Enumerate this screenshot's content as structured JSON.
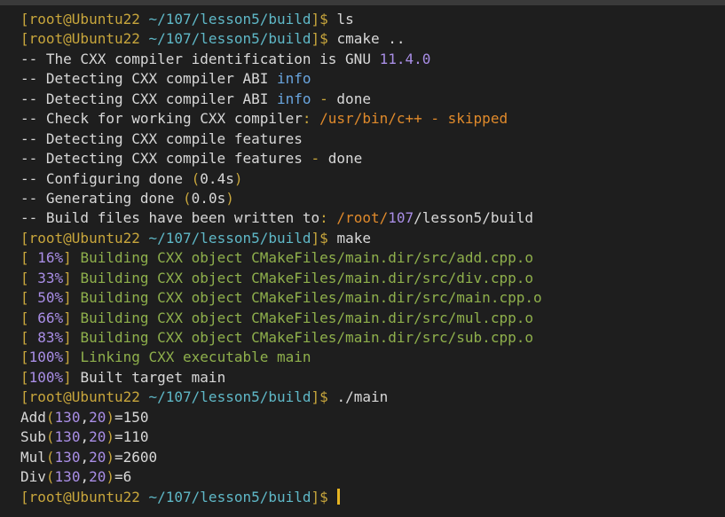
{
  "terminal": {
    "lines": [
      {
        "segments": [
          {
            "t": "[root@Ubuntu22 ",
            "c": "yellow"
          },
          {
            "t": "~/107/lesson5/build",
            "c": "cyan"
          },
          {
            "t": "]$ ",
            "c": "yellow"
          },
          {
            "t": "ls",
            "c": "default"
          }
        ]
      },
      {
        "segments": [
          {
            "t": "[root@Ubuntu22 ",
            "c": "yellow"
          },
          {
            "t": "~/107/lesson5/build",
            "c": "cyan"
          },
          {
            "t": "]$ ",
            "c": "yellow"
          },
          {
            "t": "cmake ..",
            "c": "default"
          }
        ]
      },
      {
        "segments": [
          {
            "t": "-- The CXX compiler identification is GNU ",
            "c": "default"
          },
          {
            "t": "11.4.0",
            "c": "purple"
          }
        ]
      },
      {
        "segments": [
          {
            "t": "-- Detecting CXX compiler ABI ",
            "c": "default"
          },
          {
            "t": "info",
            "c": "blue"
          }
        ]
      },
      {
        "segments": [
          {
            "t": "-- Detecting CXX compiler ABI ",
            "c": "default"
          },
          {
            "t": "info",
            "c": "blue"
          },
          {
            "t": " - ",
            "c": "yellow"
          },
          {
            "t": "done",
            "c": "default"
          }
        ]
      },
      {
        "segments": [
          {
            "t": "-- Check for working CXX compiler",
            "c": "default"
          },
          {
            "t": ": ",
            "c": "yellow"
          },
          {
            "t": "/usr/bin/c++ - skipped",
            "c": "orange"
          }
        ]
      },
      {
        "segments": [
          {
            "t": "-- Detecting CXX compile features",
            "c": "default"
          }
        ]
      },
      {
        "segments": [
          {
            "t": "-- Detecting CXX compile features ",
            "c": "default"
          },
          {
            "t": "- ",
            "c": "yellow"
          },
          {
            "t": "done",
            "c": "default"
          }
        ]
      },
      {
        "segments": [
          {
            "t": "-- Configuring done ",
            "c": "default"
          },
          {
            "t": "(",
            "c": "yellow"
          },
          {
            "t": "0.4s",
            "c": "default"
          },
          {
            "t": ")",
            "c": "yellow"
          }
        ]
      },
      {
        "segments": [
          {
            "t": "-- Generating done ",
            "c": "default"
          },
          {
            "t": "(",
            "c": "yellow"
          },
          {
            "t": "0.0s",
            "c": "default"
          },
          {
            "t": ")",
            "c": "yellow"
          }
        ]
      },
      {
        "segments": [
          {
            "t": "-- Build files have been written to",
            "c": "default"
          },
          {
            "t": ": ",
            "c": "yellow"
          },
          {
            "t": "/root/",
            "c": "orange"
          },
          {
            "t": "107",
            "c": "purple"
          },
          {
            "t": "/lesson5/build",
            "c": "default"
          }
        ]
      },
      {
        "segments": [
          {
            "t": "[root@Ubuntu22 ",
            "c": "yellow"
          },
          {
            "t": "~/107/lesson5/build",
            "c": "cyan"
          },
          {
            "t": "]$ ",
            "c": "yellow"
          },
          {
            "t": "make",
            "c": "default"
          }
        ]
      },
      {
        "segments": [
          {
            "t": "[ ",
            "c": "yellow"
          },
          {
            "t": "16%",
            "c": "purple"
          },
          {
            "t": "] ",
            "c": "yellow"
          },
          {
            "t": "Building CXX object CMakeFiles/main.dir/src/add.cpp.o",
            "c": "green"
          }
        ]
      },
      {
        "segments": [
          {
            "t": "[ ",
            "c": "yellow"
          },
          {
            "t": "33%",
            "c": "purple"
          },
          {
            "t": "] ",
            "c": "yellow"
          },
          {
            "t": "Building CXX object CMakeFiles/main.dir/src/div.cpp.o",
            "c": "green"
          }
        ]
      },
      {
        "segments": [
          {
            "t": "[ ",
            "c": "yellow"
          },
          {
            "t": "50%",
            "c": "purple"
          },
          {
            "t": "] ",
            "c": "yellow"
          },
          {
            "t": "Building CXX object CMakeFiles/main.dir/src/main.cpp.o",
            "c": "green"
          }
        ]
      },
      {
        "segments": [
          {
            "t": "[ ",
            "c": "yellow"
          },
          {
            "t": "66%",
            "c": "purple"
          },
          {
            "t": "] ",
            "c": "yellow"
          },
          {
            "t": "Building CXX object CMakeFiles/main.dir/src/mul.cpp.o",
            "c": "green"
          }
        ]
      },
      {
        "segments": [
          {
            "t": "[ ",
            "c": "yellow"
          },
          {
            "t": "83%",
            "c": "purple"
          },
          {
            "t": "] ",
            "c": "yellow"
          },
          {
            "t": "Building CXX object CMakeFiles/main.dir/src/sub.cpp.o",
            "c": "green"
          }
        ]
      },
      {
        "segments": [
          {
            "t": "[",
            "c": "yellow"
          },
          {
            "t": "100%",
            "c": "purple"
          },
          {
            "t": "] ",
            "c": "yellow"
          },
          {
            "t": "Linking CXX executable main",
            "c": "green"
          }
        ]
      },
      {
        "segments": [
          {
            "t": "[",
            "c": "yellow"
          },
          {
            "t": "100%",
            "c": "purple"
          },
          {
            "t": "] ",
            "c": "yellow"
          },
          {
            "t": "Built target main",
            "c": "default"
          }
        ]
      },
      {
        "segments": [
          {
            "t": "[root@Ubuntu22 ",
            "c": "yellow"
          },
          {
            "t": "~/107/lesson5/build",
            "c": "cyan"
          },
          {
            "t": "]$ ",
            "c": "yellow"
          },
          {
            "t": "./main",
            "c": "default"
          }
        ]
      },
      {
        "segments": [
          {
            "t": "Add",
            "c": "default"
          },
          {
            "t": "(",
            "c": "yellow"
          },
          {
            "t": "130",
            "c": "purple"
          },
          {
            "t": ",",
            "c": "default"
          },
          {
            "t": "20",
            "c": "purple"
          },
          {
            "t": ")",
            "c": "yellow"
          },
          {
            "t": "=150",
            "c": "default"
          }
        ]
      },
      {
        "segments": [
          {
            "t": "Sub",
            "c": "default"
          },
          {
            "t": "(",
            "c": "yellow"
          },
          {
            "t": "130",
            "c": "purple"
          },
          {
            "t": ",",
            "c": "default"
          },
          {
            "t": "20",
            "c": "purple"
          },
          {
            "t": ")",
            "c": "yellow"
          },
          {
            "t": "=110",
            "c": "default"
          }
        ]
      },
      {
        "segments": [
          {
            "t": "Mul",
            "c": "default"
          },
          {
            "t": "(",
            "c": "yellow"
          },
          {
            "t": "130",
            "c": "purple"
          },
          {
            "t": ",",
            "c": "default"
          },
          {
            "t": "20",
            "c": "purple"
          },
          {
            "t": ")",
            "c": "yellow"
          },
          {
            "t": "=2600",
            "c": "default"
          }
        ]
      },
      {
        "segments": [
          {
            "t": "Div",
            "c": "default"
          },
          {
            "t": "(",
            "c": "yellow"
          },
          {
            "t": "130",
            "c": "purple"
          },
          {
            "t": ",",
            "c": "default"
          },
          {
            "t": "20",
            "c": "purple"
          },
          {
            "t": ")",
            "c": "yellow"
          },
          {
            "t": "=6",
            "c": "default"
          }
        ]
      },
      {
        "segments": [
          {
            "t": "[root@Ubuntu22 ",
            "c": "yellow"
          },
          {
            "t": "~/107/lesson5/build",
            "c": "cyan"
          },
          {
            "t": "]$ ",
            "c": "yellow"
          }
        ],
        "cursor": true
      }
    ]
  },
  "colors": {
    "background": "#1e1e1e",
    "prompt_user": "#c8a63c",
    "prompt_path": "#5fb8c7",
    "default_text": "#d8d8d8",
    "build_text": "#8fb04c",
    "percent": "#a98ee6",
    "keyword_info": "#6aa6e0",
    "path_orange": "#e08a2b",
    "cursor": "#e6b422"
  }
}
